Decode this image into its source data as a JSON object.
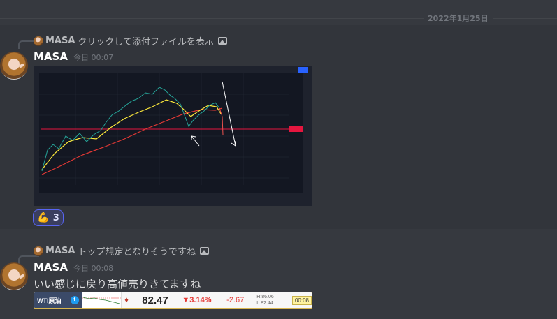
{
  "date_divider": "2022年1月25日",
  "message1": {
    "reply": {
      "author": "MASA",
      "text": "クリックして添付ファイルを表示",
      "icon": "image-icon"
    },
    "author": "MASA",
    "timestamp": "今日 00:07",
    "reaction": {
      "emoji": "💪",
      "count": "3"
    }
  },
  "message2": {
    "reply": {
      "author": "MASA",
      "text": "トップ想定となりそうですね",
      "icon": "image-icon"
    },
    "author": "MASA",
    "timestamp": "今日 00:08",
    "text": "いい感じに戻り高値売りきてますね",
    "ticker": {
      "name": "WTI原油",
      "price": "82.47",
      "change_pct": "▼3.14%",
      "change": "-2.67",
      "high": "H:86.06",
      "low": "L:82.44",
      "time": "00:08"
    }
  },
  "colors": {
    "background": "#36393f",
    "accent": "#5865f2",
    "down": "#e53935"
  }
}
